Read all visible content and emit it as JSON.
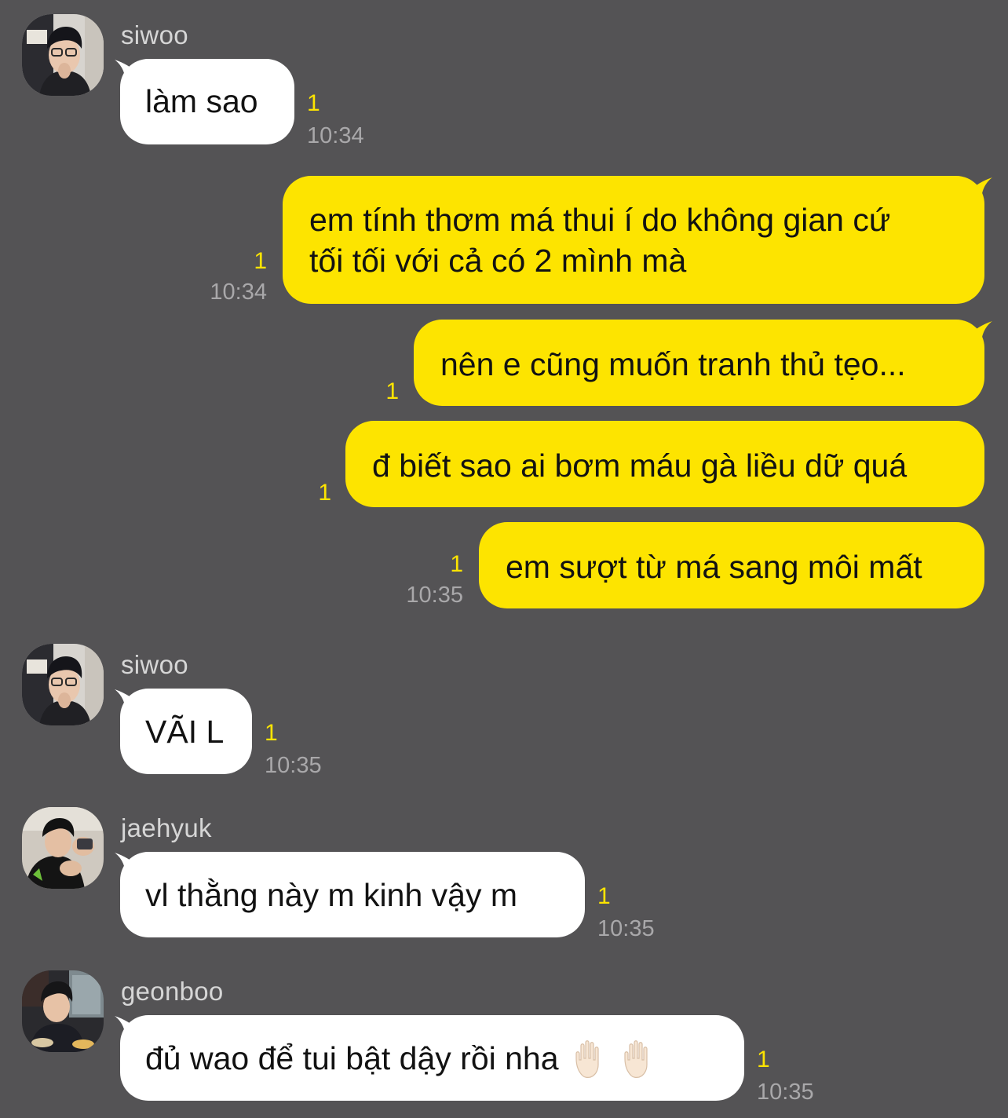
{
  "messages": [
    {
      "sender": "siwoo",
      "text": "làm sao",
      "unread": "1",
      "time": "10:34"
    },
    {
      "text_lines": [
        "em tính thơm má thui í do không gian cứ",
        "tối tối với cả có 2 mình mà"
      ],
      "unread": "1",
      "time": "10:34"
    },
    {
      "text": "nên e cũng muốn tranh thủ tẹo...",
      "unread": "1"
    },
    {
      "text": "đ biết sao ai bơm máu gà liều dữ quá",
      "unread": "1"
    },
    {
      "text": "em sượt từ má sang môi mất",
      "unread": "1",
      "time": "10:35"
    },
    {
      "sender": "siwoo",
      "text": "VÃI L",
      "unread": "1",
      "time": "10:35"
    },
    {
      "sender": "jaehyuk",
      "text": "vl thằng này m kinh vậy m",
      "unread": "1",
      "time": "10:35"
    },
    {
      "sender": "geonboo",
      "text": "đủ wao để tui bật dậy rồi nha",
      "emoji": [
        "raised-hand-icon",
        "raised-hand-icon"
      ],
      "unread": "1",
      "time": "10:35"
    }
  ],
  "colors": {
    "background": "#545355",
    "incoming_bubble": "#ffffff",
    "outgoing_bubble": "#fde400",
    "unread_count": "#fde400",
    "timestamp": "#a9a8aa",
    "sender_name": "#d6d6d6"
  }
}
